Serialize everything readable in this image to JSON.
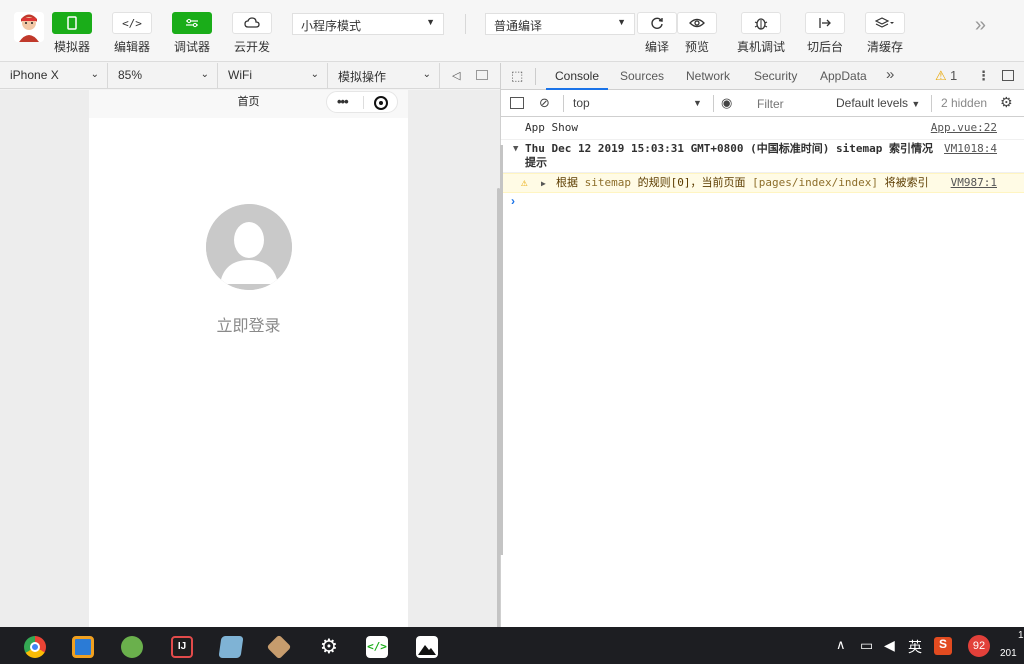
{
  "toolbar": {
    "simulator": "模拟器",
    "editor": "编辑器",
    "debugger": "调试器",
    "cloud": "云开发",
    "mode_select": "小程序模式",
    "compile_select": "普通编译",
    "compile": "编译",
    "preview": "预览",
    "remote_debug": "真机调试",
    "background": "切后台",
    "clear_cache": "清缓存"
  },
  "sim_bar": {
    "device": "iPhone X",
    "zoom": "85%",
    "network": "WiFi",
    "operation": "模拟操作"
  },
  "phone": {
    "title": "首页",
    "login": "立即登录"
  },
  "devtools": {
    "tabs": [
      "Console",
      "Sources",
      "Network",
      "Security",
      "AppData"
    ],
    "warn_count": "1",
    "context": "top",
    "filter_placeholder": "Filter",
    "levels": "Default levels",
    "hidden": "2 hidden",
    "lines": [
      {
        "text": "App Show",
        "src": "App.vue:22"
      },
      {
        "text": "Thu Dec 12 2019 15:03:31 GMT+0800 (中国标准时间) sitemap 索引情况提示",
        "src": "VM1018:4"
      },
      {
        "prefix": "根据 ",
        "code1": "sitemap",
        "mid": " 的规则[0]，当前页面 ",
        "code2": "[pages/index/index]",
        "suffix": " 将被索引",
        "src": "VM987:1"
      }
    ]
  },
  "taskbar": {
    "lang": "英",
    "badge": "92",
    "clock_top": "1",
    "clock_bottom": "201"
  }
}
